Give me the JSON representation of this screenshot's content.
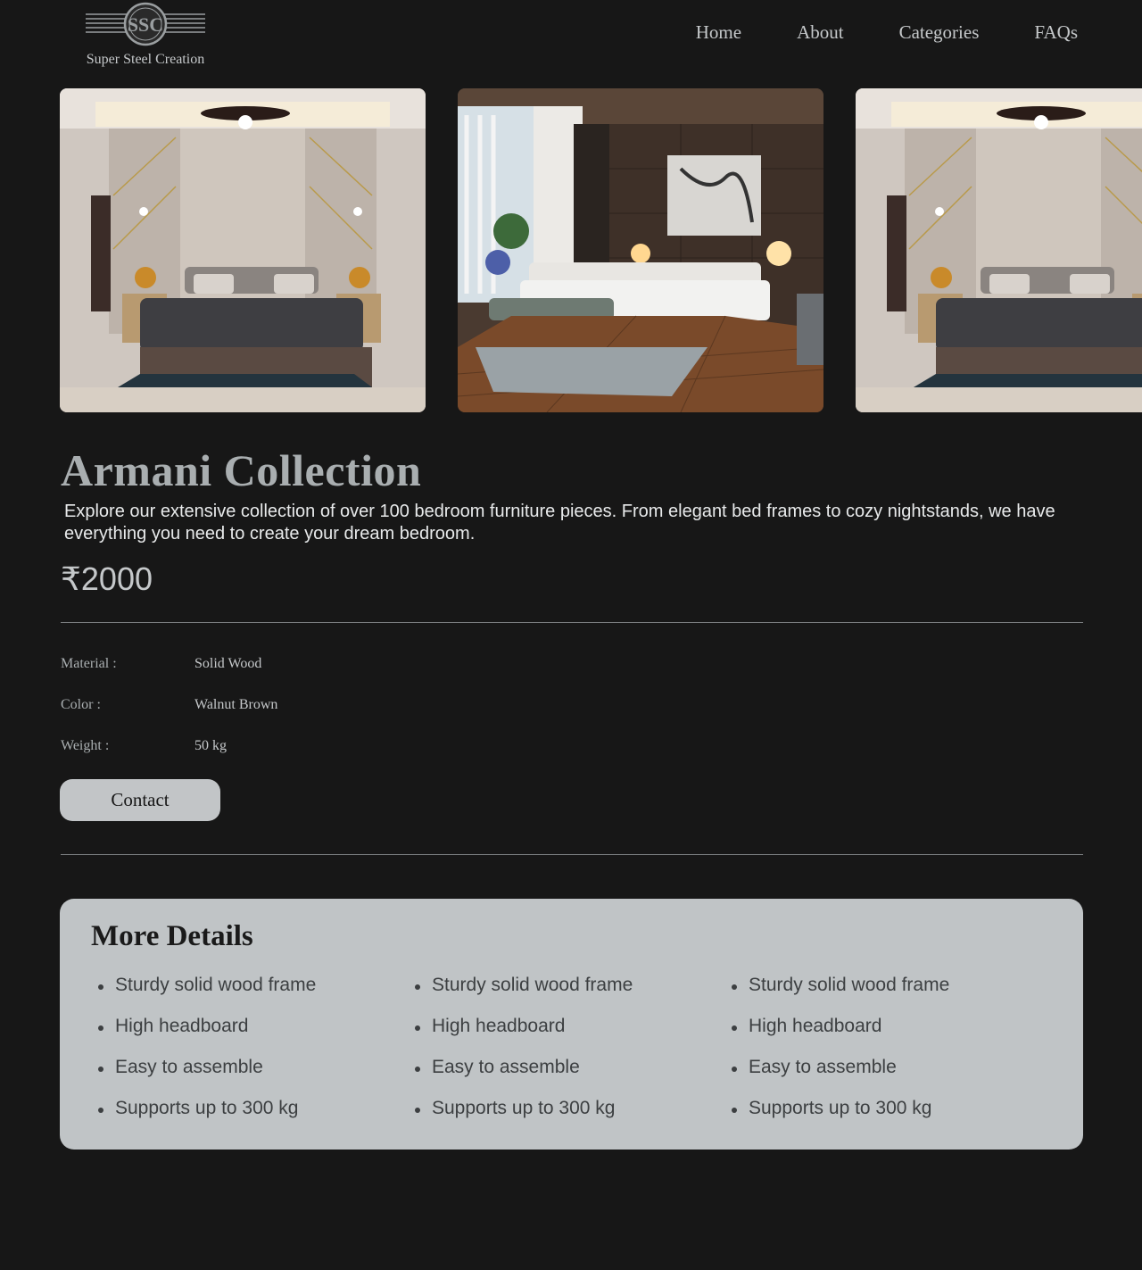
{
  "brand": {
    "name": "Super Steel Creation",
    "logo_letters": "SSC"
  },
  "nav": {
    "items": [
      {
        "label": "Home"
      },
      {
        "label": "About"
      },
      {
        "label": "Categories"
      },
      {
        "label": "FAQs"
      }
    ]
  },
  "gallery": {
    "images": [
      {
        "name": "bedroom-image-1",
        "description": "grey bedroom with ceiling fan"
      },
      {
        "name": "bedroom-image-2",
        "description": "wooden bedroom with window"
      },
      {
        "name": "bedroom-image-3",
        "description": "grey bedroom with ceiling fan"
      }
    ]
  },
  "product": {
    "title": "Armani Collection",
    "description": "Explore our extensive collection of over 100 bedroom furniture pieces. From elegant bed frames to cozy nightstands, we have everything you need to create your dream bedroom.",
    "price": "₹2000",
    "specs": [
      {
        "label": "Material :",
        "value": "Solid Wood"
      },
      {
        "label": "Color :",
        "value": "Walnut Brown"
      },
      {
        "label": "Weight :",
        "value": "50 kg"
      }
    ],
    "contact_label": "Contact"
  },
  "details": {
    "title": "More Details",
    "columns": [
      [
        "Sturdy solid wood frame",
        "High headboard",
        "Easy to assemble",
        "Supports up to 300 kg"
      ],
      [
        "Sturdy solid wood frame",
        "High headboard",
        "Easy to assemble",
        "Supports up to 300 kg"
      ],
      [
        "Sturdy solid wood frame",
        "High headboard",
        "Easy to assemble",
        "Supports up to 300 kg"
      ]
    ]
  },
  "colors": {
    "background": "#171717",
    "text": "#c5c8ca",
    "card": "#c0c4c6",
    "button": "#c2c5c7"
  }
}
